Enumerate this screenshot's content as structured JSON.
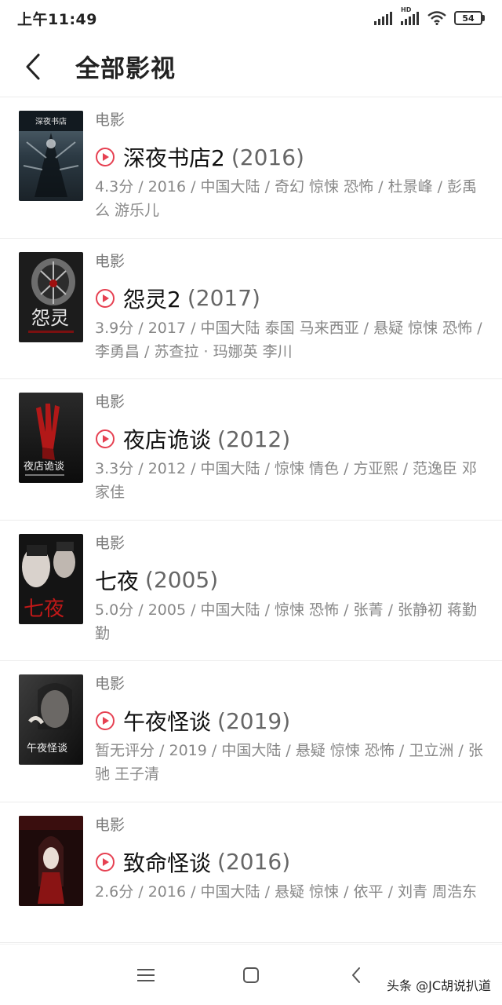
{
  "status_bar": {
    "time": "上午11:49",
    "network_type": "HD",
    "battery": "54"
  },
  "header": {
    "title": "全部影视"
  },
  "accent_color": "#e64152",
  "items": [
    {
      "category": "电影",
      "title": "深夜书店2",
      "year": "(2016)",
      "has_play": true,
      "meta": "4.3分 / 2016 / 中国大陆 / 奇幻 惊悚 恐怖 / 杜景峰 / 彭禹么 游乐儿",
      "poster_text": "深夜书店"
    },
    {
      "category": "电影",
      "title": "怨灵2",
      "year": "(2017)",
      "has_play": true,
      "meta": "3.9分 / 2017 / 中国大陆 泰国 马来西亚 / 悬疑 惊悚 恐怖 / 李勇昌 / 苏查拉 · 玛娜英 李川",
      "poster_text": "怨灵"
    },
    {
      "category": "电影",
      "title": "夜店诡谈",
      "year": "(2012)",
      "has_play": true,
      "meta": "3.3分 / 2012 / 中国大陆 / 惊悚 情色 / 方亚熙 / 范逸臣 邓家佳",
      "poster_text": "夜店诡谈"
    },
    {
      "category": "电影",
      "title": "七夜",
      "year": "(2005)",
      "has_play": false,
      "meta": "5.0分 / 2005 / 中国大陆 / 惊悚 恐怖 / 张菁 / 张静初 蒋勤勤",
      "poster_text": "七夜"
    },
    {
      "category": "电影",
      "title": "午夜怪谈",
      "year": "(2019)",
      "has_play": true,
      "meta": "暂无评分 / 2019 / 中国大陆 / 悬疑 惊悚 恐怖 / 卫立洲 / 张驰 王子清",
      "poster_text": "午夜怪谈"
    },
    {
      "category": "电影",
      "title": "致命怪谈",
      "year": "(2016)",
      "has_play": true,
      "meta": "2.6分 / 2016 / 中国大陆 / 悬疑 惊悚 / 依平 / 刘青 周浩东",
      "poster_text": ""
    }
  ],
  "nav": {
    "menu_icon": "menu-icon",
    "home_icon": "home-icon",
    "back_icon": "back-icon"
  },
  "watermark": "头条 @JC胡说扒道"
}
